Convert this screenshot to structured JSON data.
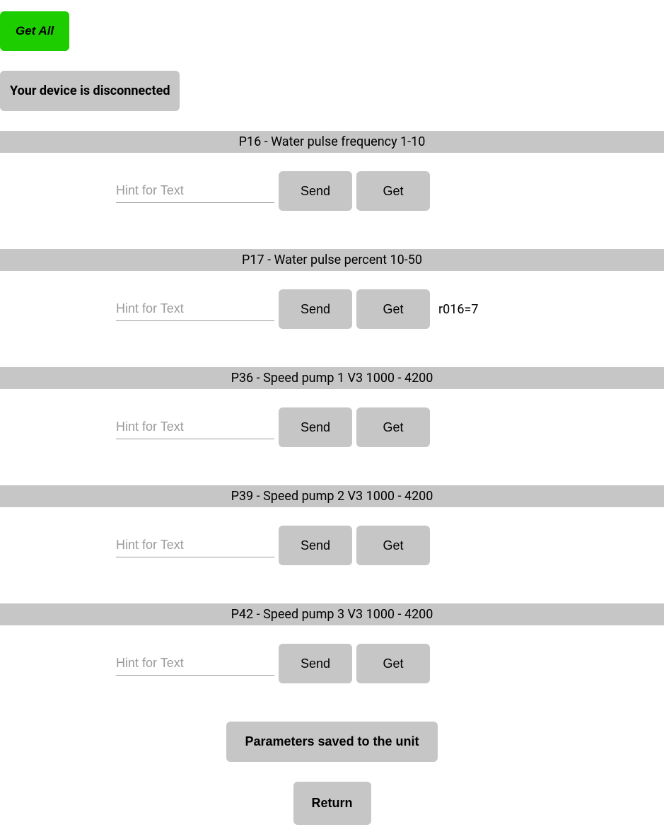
{
  "header": {
    "get_all_label": "Get  All",
    "status_text": "Your device is disconnected"
  },
  "common": {
    "input_placeholder": "Hint for Text",
    "send_label": "Send",
    "get_label": "Get"
  },
  "params": [
    {
      "id": "P16",
      "title": "P16 - Water pulse frequency 1-10",
      "value": "",
      "readout": ""
    },
    {
      "id": "P17",
      "title": "P17 - Water pulse percent 10-50",
      "value": "",
      "readout": "r016=7"
    },
    {
      "id": "P36",
      "title": "P36 - Speed pump 1 V3 1000 - 4200",
      "value": "",
      "readout": ""
    },
    {
      "id": "P39",
      "title": "P39 - Speed pump 2 V3 1000 - 4200",
      "value": "",
      "readout": ""
    },
    {
      "id": "P42",
      "title": "P42 - Speed pump 3 V3 1000 - 4200",
      "value": "",
      "readout": ""
    }
  ],
  "footer": {
    "saved_label": "Parameters saved to the unit",
    "return_label": "Return"
  }
}
